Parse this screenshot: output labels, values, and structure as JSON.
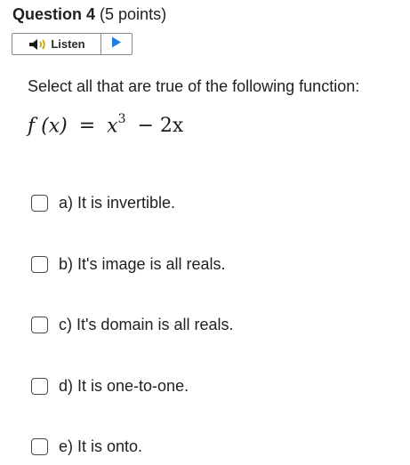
{
  "question": {
    "title": "Question 4",
    "points": "(5 points)"
  },
  "listen": {
    "label": "Listen",
    "speaker_icon": "speaker-icon",
    "play_icon": "play-icon",
    "accent_color": "#1a7ee0"
  },
  "prompt": "Select all that are true of the following function:",
  "formula": {
    "lhs": "f (x)",
    "equals": "=",
    "base": "x",
    "exponent": "3",
    "rest": "− 2x"
  },
  "options": [
    {
      "label": "a)  It is invertible.",
      "checked": false
    },
    {
      "label": "b)  It's image is all reals.",
      "checked": false
    },
    {
      "label": "c)  It's domain is all reals.",
      "checked": false
    },
    {
      "label": "d)  It is one-to-one.",
      "checked": false
    },
    {
      "label": "e)  It is onto.",
      "checked": false
    }
  ]
}
